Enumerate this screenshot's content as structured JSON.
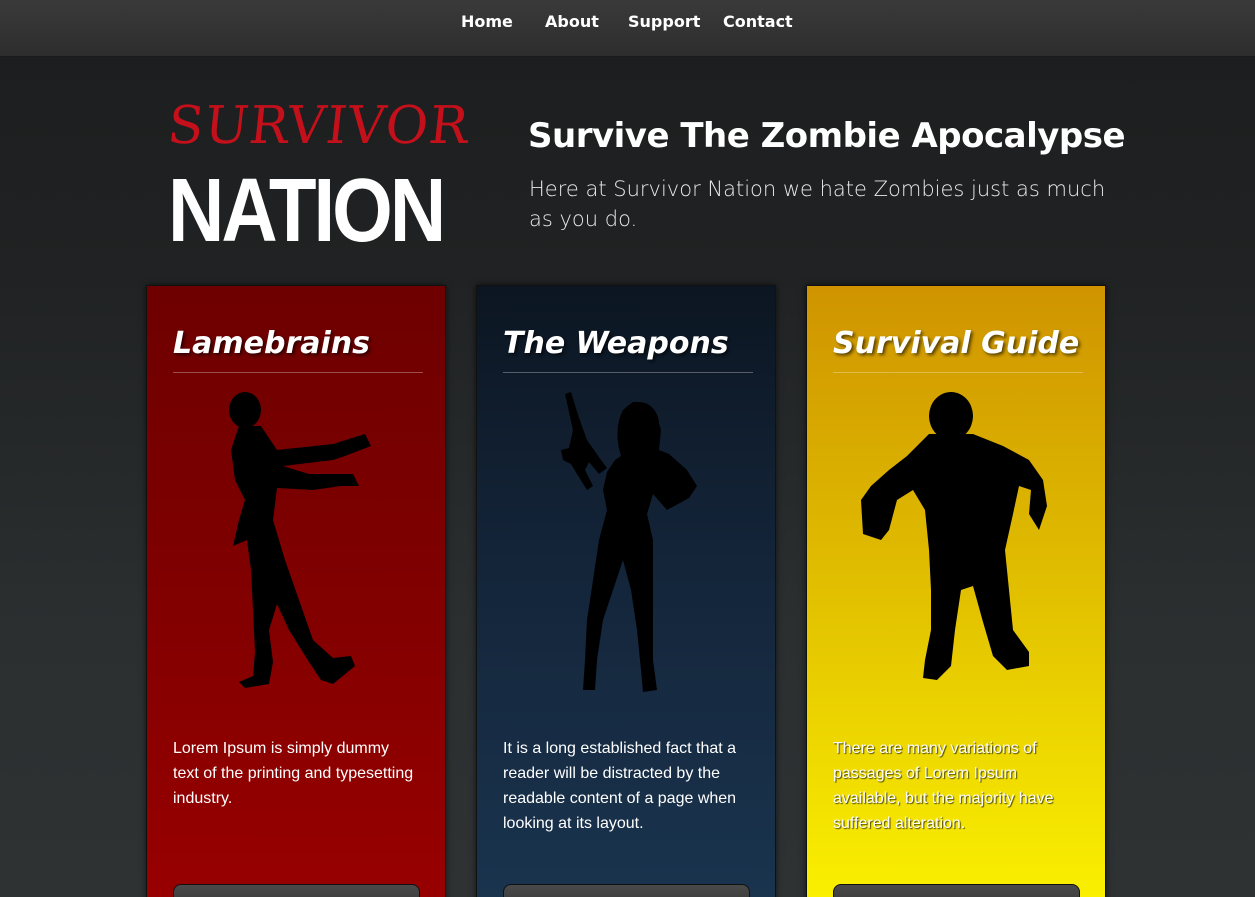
{
  "nav": {
    "items": [
      "Home",
      "About",
      "Support",
      "Contact"
    ]
  },
  "logo": {
    "line1": "SURVIVOR",
    "line2": "NATION"
  },
  "hero": {
    "title": "Survive The Zombie Apocalypse",
    "subtitle": "Here at Survivor Nation we hate Zombies just as much as you do."
  },
  "cards": [
    {
      "title": "Lamebrains",
      "text": "Lorem Ipsum is simply dummy text of the printing and typesetting industry.",
      "figure": "walking-zombie-silhouette",
      "color": "#8a0000"
    },
    {
      "title": "The Weapons",
      "text": "It is a long established fact that a reader will be distracted by the readable content of a page when looking at its layout.",
      "figure": "woman-with-rifle-silhouette",
      "color": "#14253a"
    },
    {
      "title": "Survival Guide",
      "text": "There are many variations of passages of Lorem Ipsum available, but the majority have suffered alteration.",
      "figure": "ragged-zombie-silhouette",
      "color": "#e0bd00"
    }
  ]
}
